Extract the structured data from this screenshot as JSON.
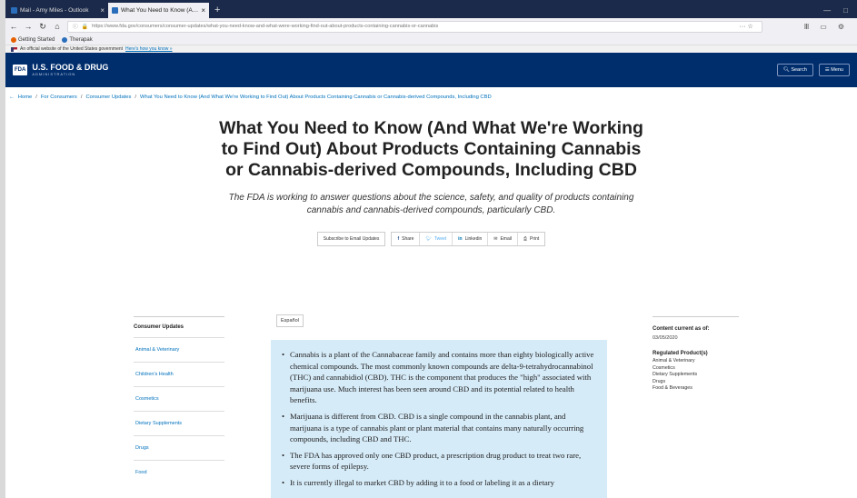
{
  "browser": {
    "tabs": [
      {
        "title": "Mail - Amy Miles - Outlook",
        "active": false
      },
      {
        "title": "What You Need to Know (And W...",
        "active": true
      }
    ],
    "url": "https://www.fda.gov/consumers/consumer-updates/what-you-need-know-and-what-were-working-find-out-about-products-containing-cannabis-or-cannabis",
    "url_domain_hint": "fda.gov",
    "bookmarks": [
      "Getting Started",
      "Therapak"
    ],
    "gov_banner": "An official website of the United States government",
    "gov_banner_link": "Here's how you know »"
  },
  "header": {
    "logo_mark": "FDA",
    "agency_name": "U.S. FOOD & DRUG",
    "agency_sub": "ADMINISTRATION",
    "search_label": "Search",
    "menu_label": "Menu"
  },
  "breadcrumb": {
    "items": [
      "Home",
      "For Consumers",
      "Consumer Updates"
    ],
    "current": "What You Need to Know (And What We're Working to Find Out) About Products Containing Cannabis or Cannabis-derived Compounds, Including CBD"
  },
  "hero": {
    "title": "What You Need to Know (And What We're Working to Find Out) About Products Containing Cannabis or Cannabis-derived Compounds, Including CBD",
    "lede": "The FDA is working to answer questions about the science, safety, and quality of products containing cannabis and cannabis-derived compounds, particularly CBD."
  },
  "share": {
    "subscribe": "Subscribe to Email Updates",
    "facebook": "Share",
    "twitter": "Tweet",
    "linkedin": "Linkedin",
    "email": "Email",
    "print": "Print"
  },
  "sidebar": {
    "heading": "Consumer Updates",
    "items": [
      "Animal & Veterinary",
      "Children's Health",
      "Cosmetics",
      "Dietary Supplements",
      "Drugs",
      "Food"
    ]
  },
  "language": "Español",
  "facts": [
    "Cannabis is a plant of the Cannabaceae family and contains more than eighty biologically active chemical compounds. The most commonly known compounds are delta-9-tetrahydrocannabinol (THC) and cannabidiol (CBD). THC is the component that produces the \"high\" associated with marijuana use. Much interest has been seen around CBD and its potential related to health benefits.",
    "Marijuana is different from CBD. CBD is a single compound in the cannabis plant, and marijuana is a type of cannabis plant or plant material that contains many naturally occurring compounds, including CBD and THC.",
    "The FDA has approved only one CBD product, a prescription drug product to treat two rare, severe forms of epilepsy.",
    "It is currently illegal to market CBD by adding it to a food or labeling it as a dietary"
  ],
  "rightcol": {
    "content_label": "Content current as of:",
    "content_date": "03/05/2020",
    "regulated_heading": "Regulated Product(s)",
    "regulated_items": [
      "Animal & Veterinary",
      "Cosmetics",
      "Dietary Supplements",
      "Drugs",
      "Food & Beverages"
    ]
  }
}
